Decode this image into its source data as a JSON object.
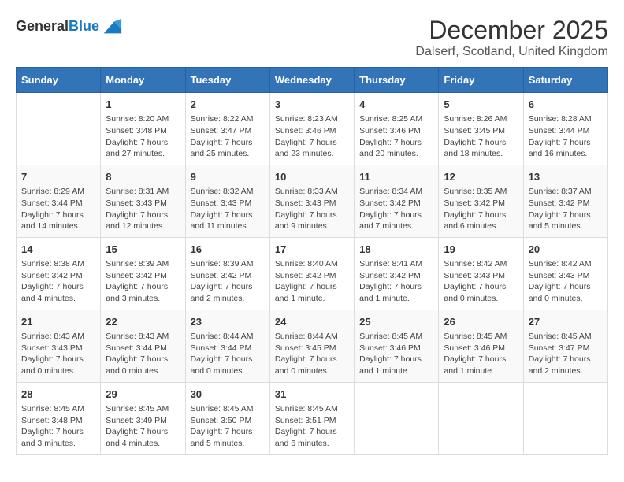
{
  "header": {
    "logo_line1": "General",
    "logo_line2": "Blue",
    "main_title": "December 2025",
    "subtitle": "Dalserf, Scotland, United Kingdom"
  },
  "days_of_week": [
    "Sunday",
    "Monday",
    "Tuesday",
    "Wednesday",
    "Thursday",
    "Friday",
    "Saturday"
  ],
  "weeks": [
    [
      {
        "day": "",
        "info": ""
      },
      {
        "day": "1",
        "info": "Sunrise: 8:20 AM\nSunset: 3:48 PM\nDaylight: 7 hours\nand 27 minutes."
      },
      {
        "day": "2",
        "info": "Sunrise: 8:22 AM\nSunset: 3:47 PM\nDaylight: 7 hours\nand 25 minutes."
      },
      {
        "day": "3",
        "info": "Sunrise: 8:23 AM\nSunset: 3:46 PM\nDaylight: 7 hours\nand 23 minutes."
      },
      {
        "day": "4",
        "info": "Sunrise: 8:25 AM\nSunset: 3:46 PM\nDaylight: 7 hours\nand 20 minutes."
      },
      {
        "day": "5",
        "info": "Sunrise: 8:26 AM\nSunset: 3:45 PM\nDaylight: 7 hours\nand 18 minutes."
      },
      {
        "day": "6",
        "info": "Sunrise: 8:28 AM\nSunset: 3:44 PM\nDaylight: 7 hours\nand 16 minutes."
      }
    ],
    [
      {
        "day": "7",
        "info": "Sunrise: 8:29 AM\nSunset: 3:44 PM\nDaylight: 7 hours\nand 14 minutes."
      },
      {
        "day": "8",
        "info": "Sunrise: 8:31 AM\nSunset: 3:43 PM\nDaylight: 7 hours\nand 12 minutes."
      },
      {
        "day": "9",
        "info": "Sunrise: 8:32 AM\nSunset: 3:43 PM\nDaylight: 7 hours\nand 11 minutes."
      },
      {
        "day": "10",
        "info": "Sunrise: 8:33 AM\nSunset: 3:43 PM\nDaylight: 7 hours\nand 9 minutes."
      },
      {
        "day": "11",
        "info": "Sunrise: 8:34 AM\nSunset: 3:42 PM\nDaylight: 7 hours\nand 7 minutes."
      },
      {
        "day": "12",
        "info": "Sunrise: 8:35 AM\nSunset: 3:42 PM\nDaylight: 7 hours\nand 6 minutes."
      },
      {
        "day": "13",
        "info": "Sunrise: 8:37 AM\nSunset: 3:42 PM\nDaylight: 7 hours\nand 5 minutes."
      }
    ],
    [
      {
        "day": "14",
        "info": "Sunrise: 8:38 AM\nSunset: 3:42 PM\nDaylight: 7 hours\nand 4 minutes."
      },
      {
        "day": "15",
        "info": "Sunrise: 8:39 AM\nSunset: 3:42 PM\nDaylight: 7 hours\nand 3 minutes."
      },
      {
        "day": "16",
        "info": "Sunrise: 8:39 AM\nSunset: 3:42 PM\nDaylight: 7 hours\nand 2 minutes."
      },
      {
        "day": "17",
        "info": "Sunrise: 8:40 AM\nSunset: 3:42 PM\nDaylight: 7 hours\nand 1 minute."
      },
      {
        "day": "18",
        "info": "Sunrise: 8:41 AM\nSunset: 3:42 PM\nDaylight: 7 hours\nand 1 minute."
      },
      {
        "day": "19",
        "info": "Sunrise: 8:42 AM\nSunset: 3:43 PM\nDaylight: 7 hours\nand 0 minutes."
      },
      {
        "day": "20",
        "info": "Sunrise: 8:42 AM\nSunset: 3:43 PM\nDaylight: 7 hours\nand 0 minutes."
      }
    ],
    [
      {
        "day": "21",
        "info": "Sunrise: 8:43 AM\nSunset: 3:43 PM\nDaylight: 7 hours\nand 0 minutes."
      },
      {
        "day": "22",
        "info": "Sunrise: 8:43 AM\nSunset: 3:44 PM\nDaylight: 7 hours\nand 0 minutes."
      },
      {
        "day": "23",
        "info": "Sunrise: 8:44 AM\nSunset: 3:44 PM\nDaylight: 7 hours\nand 0 minutes."
      },
      {
        "day": "24",
        "info": "Sunrise: 8:44 AM\nSunset: 3:45 PM\nDaylight: 7 hours\nand 0 minutes."
      },
      {
        "day": "25",
        "info": "Sunrise: 8:45 AM\nSunset: 3:46 PM\nDaylight: 7 hours\nand 1 minute."
      },
      {
        "day": "26",
        "info": "Sunrise: 8:45 AM\nSunset: 3:46 PM\nDaylight: 7 hours\nand 1 minute."
      },
      {
        "day": "27",
        "info": "Sunrise: 8:45 AM\nSunset: 3:47 PM\nDaylight: 7 hours\nand 2 minutes."
      }
    ],
    [
      {
        "day": "28",
        "info": "Sunrise: 8:45 AM\nSunset: 3:48 PM\nDaylight: 7 hours\nand 3 minutes."
      },
      {
        "day": "29",
        "info": "Sunrise: 8:45 AM\nSunset: 3:49 PM\nDaylight: 7 hours\nand 4 minutes."
      },
      {
        "day": "30",
        "info": "Sunrise: 8:45 AM\nSunset: 3:50 PM\nDaylight: 7 hours\nand 5 minutes."
      },
      {
        "day": "31",
        "info": "Sunrise: 8:45 AM\nSunset: 3:51 PM\nDaylight: 7 hours\nand 6 minutes."
      },
      {
        "day": "",
        "info": ""
      },
      {
        "day": "",
        "info": ""
      },
      {
        "day": "",
        "info": ""
      }
    ]
  ]
}
